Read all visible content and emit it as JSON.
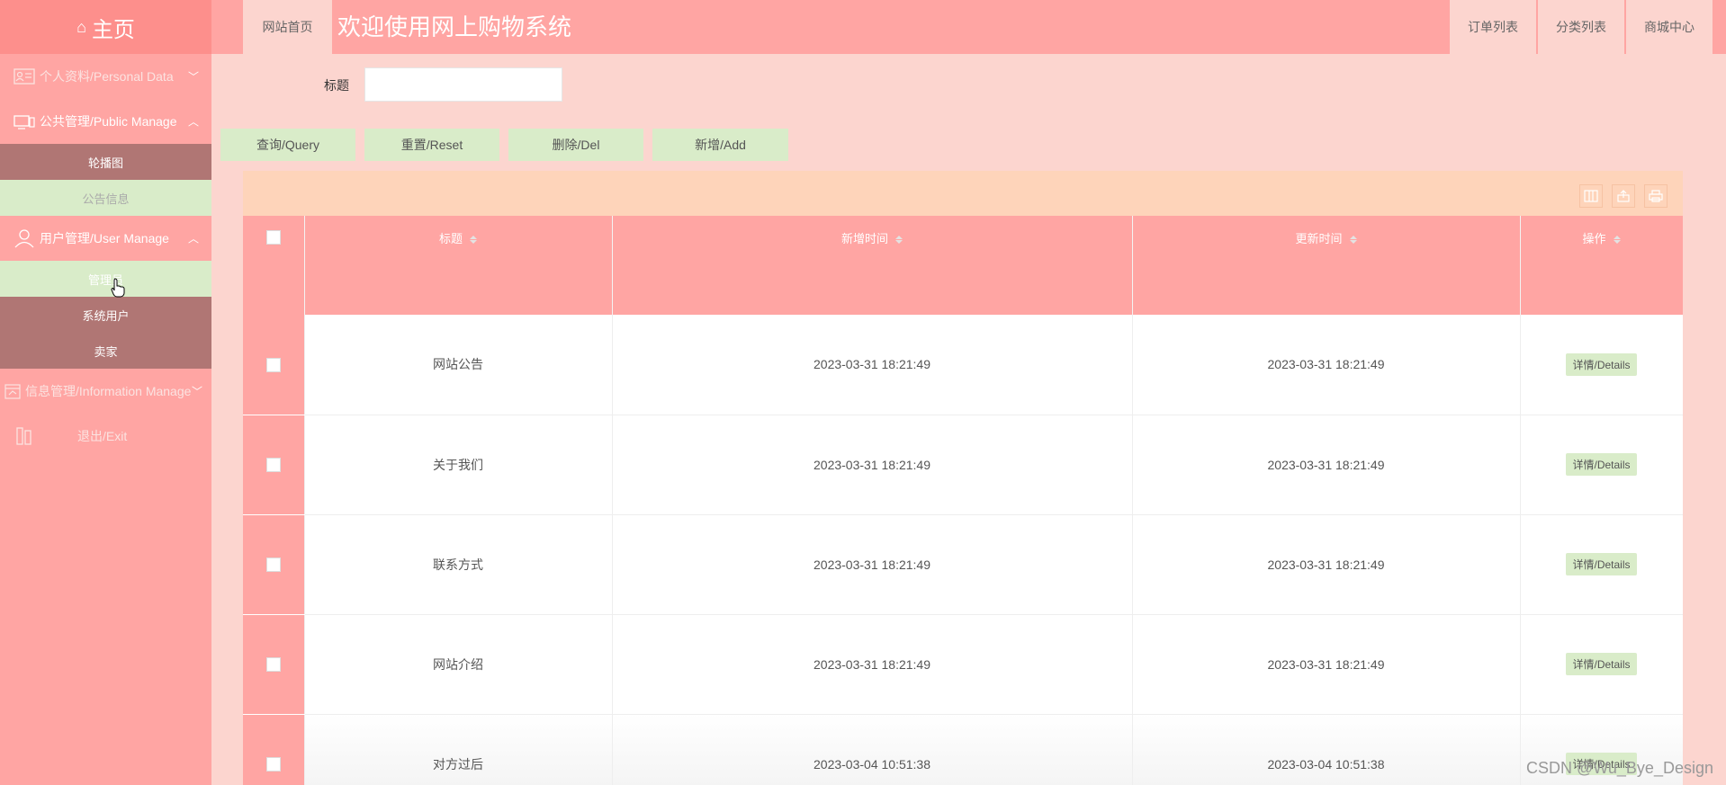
{
  "sidebar": {
    "home": "主页",
    "items": [
      {
        "label": "个人资料/Personal Data"
      },
      {
        "label": "公共管理/Public Manage"
      },
      {
        "label": "用户管理/User Manage"
      },
      {
        "label": "信息管理/Information Manage"
      },
      {
        "label": "退出/Exit"
      }
    ],
    "public_subs": [
      "轮播图",
      "公告信息"
    ],
    "user_subs": [
      "管理员",
      "系统用户",
      "卖家"
    ]
  },
  "topbar": {
    "home_link": "网站首页",
    "title": "欢迎使用网上购物系统",
    "links": [
      "订单列表",
      "分类列表",
      "商城中心"
    ]
  },
  "search": {
    "label": "标题",
    "value": ""
  },
  "buttons": {
    "query": "查询/Query",
    "reset": "重置/Reset",
    "del": "删除/Del",
    "add": "新增/Add"
  },
  "table": {
    "headers": [
      "标题",
      "新增时间",
      "更新时间",
      "操作"
    ],
    "rows": [
      {
        "title": "网站公告",
        "created": "2023-03-31 18:21:49",
        "updated": "2023-03-31 18:21:49",
        "action": "详情/Details"
      },
      {
        "title": "关于我们",
        "created": "2023-03-31 18:21:49",
        "updated": "2023-03-31 18:21:49",
        "action": "详情/Details"
      },
      {
        "title": "联系方式",
        "created": "2023-03-31 18:21:49",
        "updated": "2023-03-31 18:21:49",
        "action": "详情/Details"
      },
      {
        "title": "网站介绍",
        "created": "2023-03-31 18:21:49",
        "updated": "2023-03-31 18:21:49",
        "action": "详情/Details"
      },
      {
        "title": "对方过后",
        "created": "2023-03-04 10:51:38",
        "updated": "2023-03-04 10:51:38",
        "action": "详情/Details"
      }
    ]
  },
  "watermark": "CSDN @Wu_Bye_Design"
}
